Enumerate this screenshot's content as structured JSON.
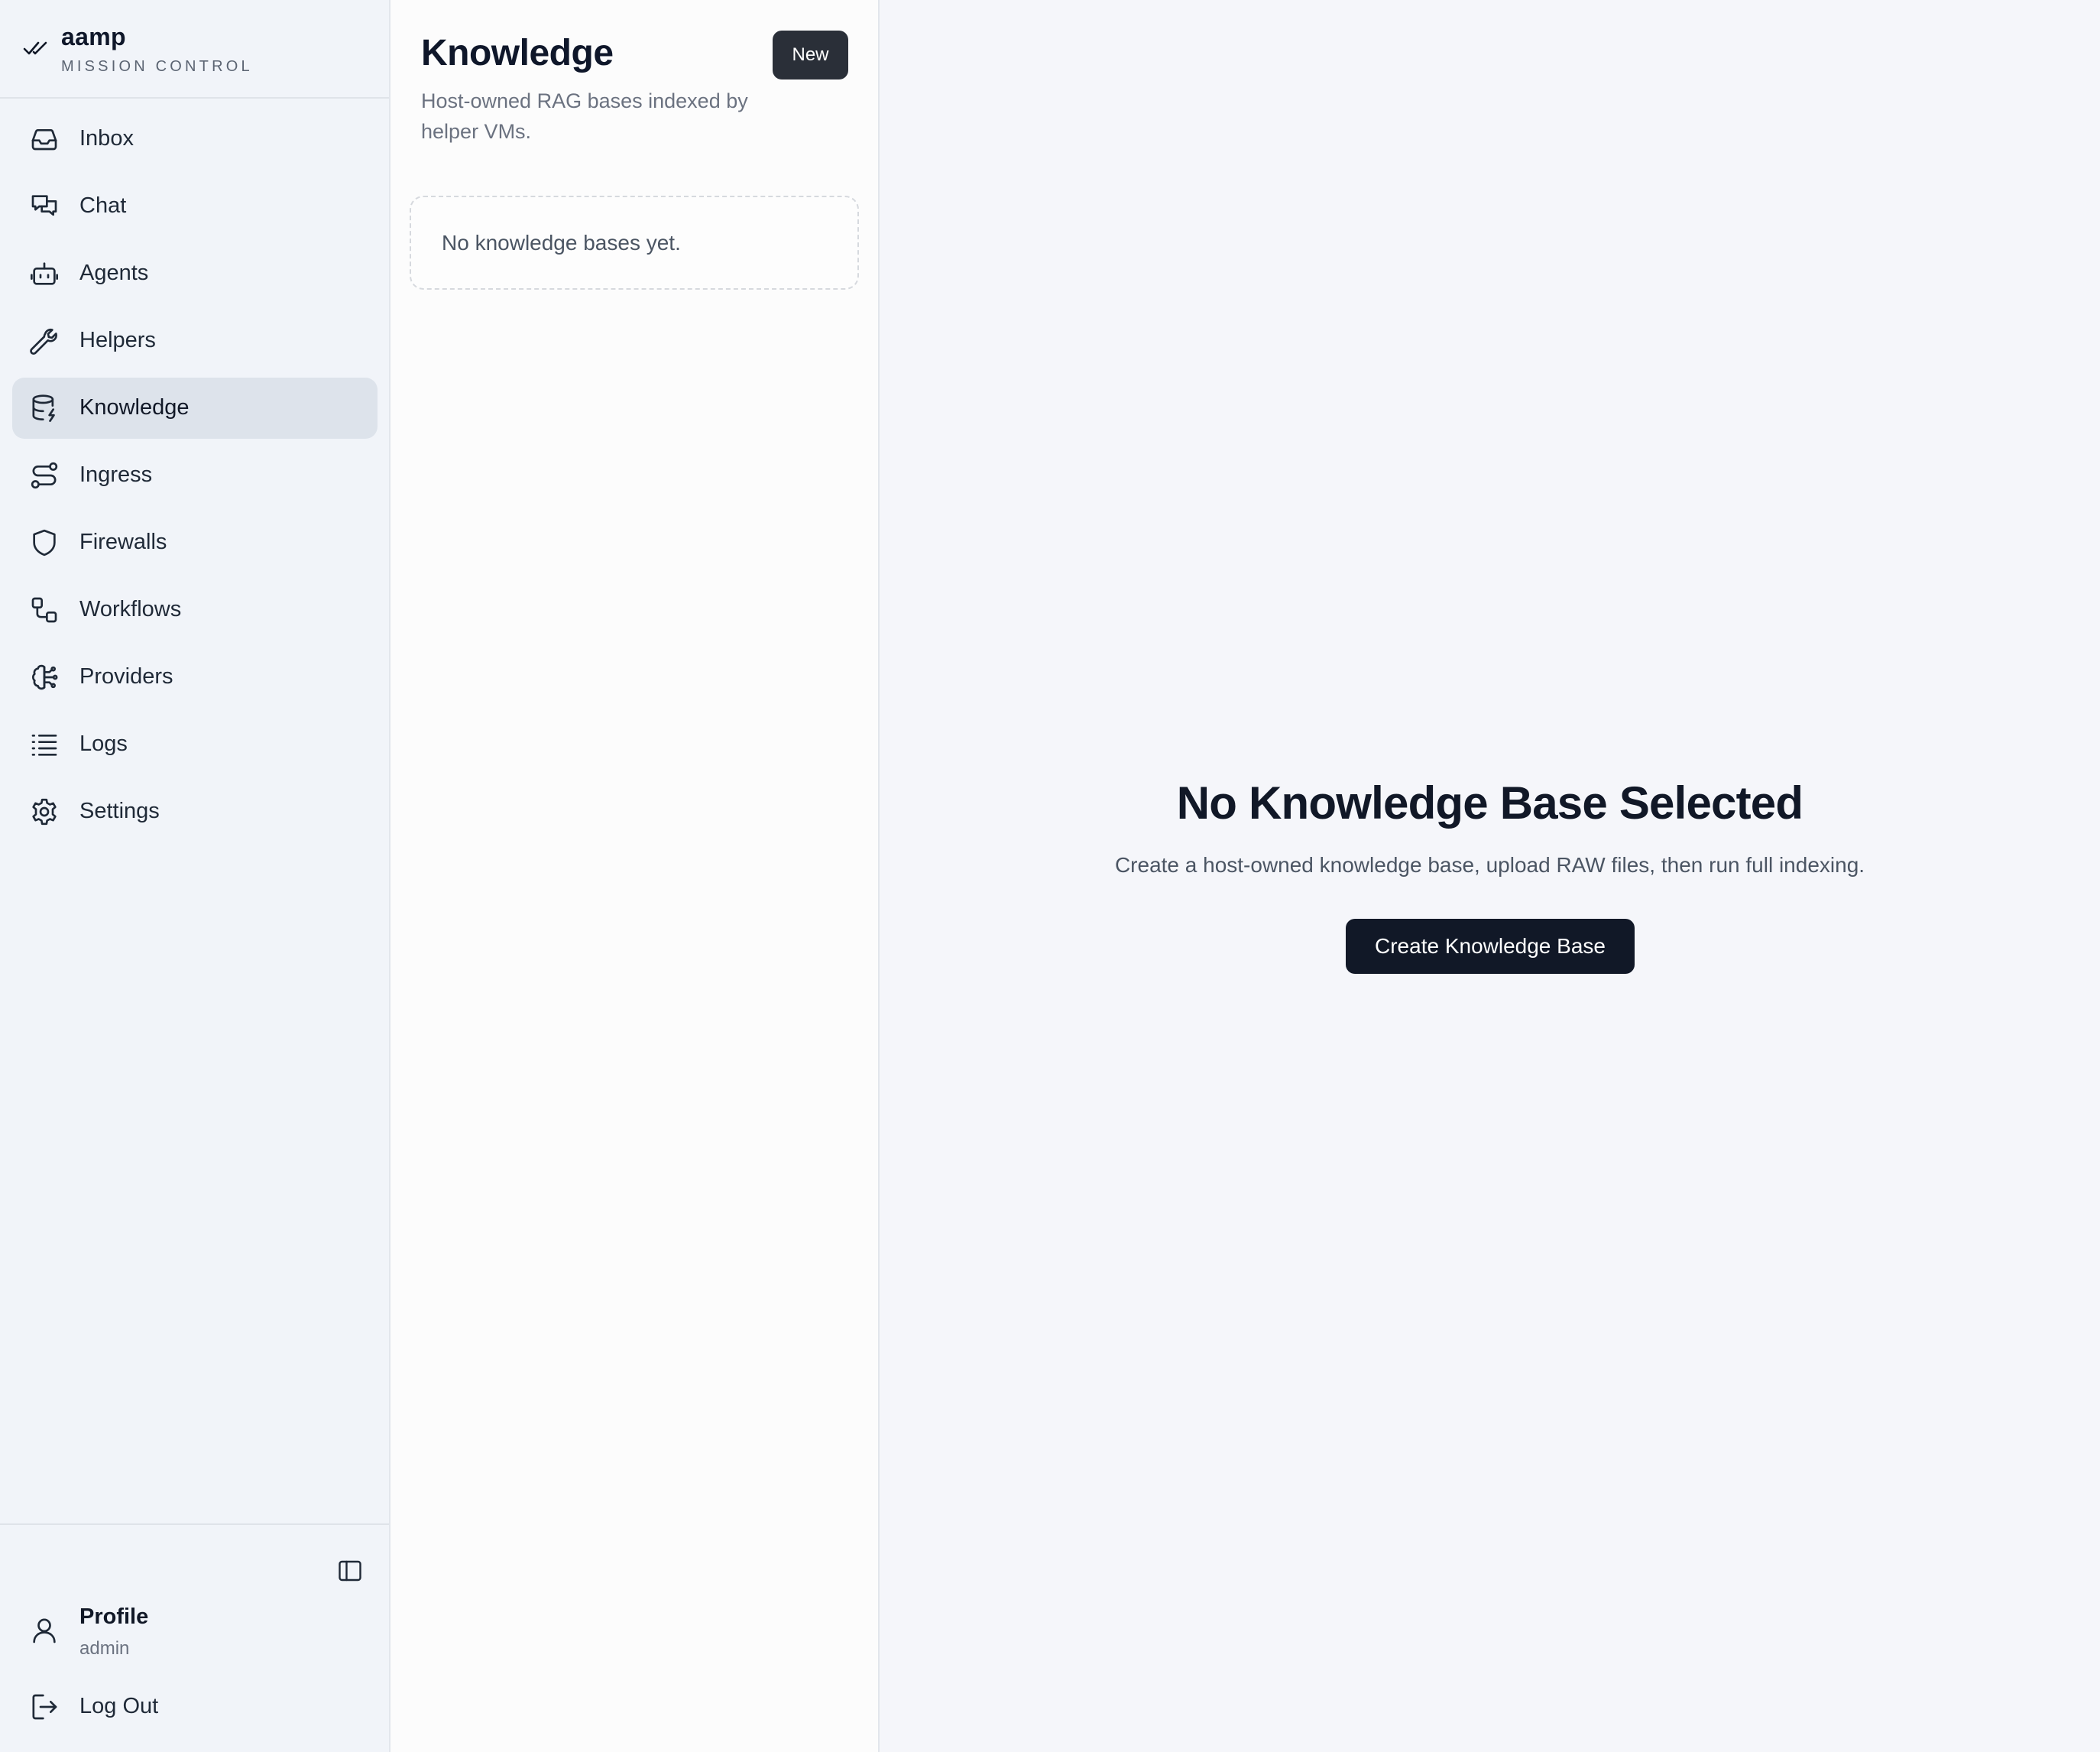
{
  "brand": {
    "name": "aamp",
    "subtitle": "MISSION CONTROL",
    "icon": "double-check-icon"
  },
  "sidebar": {
    "items": [
      {
        "label": "Inbox",
        "icon": "inbox-icon",
        "active": false
      },
      {
        "label": "Chat",
        "icon": "chat-icon",
        "active": false
      },
      {
        "label": "Agents",
        "icon": "robot-icon",
        "active": false
      },
      {
        "label": "Helpers",
        "icon": "wrench-icon",
        "active": false
      },
      {
        "label": "Knowledge",
        "icon": "database-icon",
        "active": true
      },
      {
        "label": "Ingress",
        "icon": "route-icon",
        "active": false
      },
      {
        "label": "Firewalls",
        "icon": "shield-icon",
        "active": false
      },
      {
        "label": "Workflows",
        "icon": "workflow-icon",
        "active": false
      },
      {
        "label": "Providers",
        "icon": "brain-icon",
        "active": false
      },
      {
        "label": "Logs",
        "icon": "list-icon",
        "active": false
      },
      {
        "label": "Settings",
        "icon": "gear-icon",
        "active": false
      }
    ],
    "collapse_icon": "sidebar-toggle-icon",
    "profile": {
      "label": "Profile",
      "role": "admin",
      "icon": "user-icon"
    },
    "logout": {
      "label": "Log Out",
      "icon": "logout-icon"
    }
  },
  "list_panel": {
    "title": "Knowledge",
    "subtitle": "Host-owned RAG bases indexed by helper VMs.",
    "new_label": "New",
    "empty_text": "No knowledge bases yet."
  },
  "main": {
    "title": "No Knowledge Base Selected",
    "description": "Create a host-owned knowledge base, upload RAW files, then run full indexing.",
    "create_label": "Create Knowledge Base"
  },
  "colors": {
    "sidebar_bg": "#f1f4f9",
    "active_item_bg": "#dde3eb",
    "primary_button": "#111827",
    "new_button": "#2a2f38",
    "main_bg": "#f5f6fa"
  }
}
